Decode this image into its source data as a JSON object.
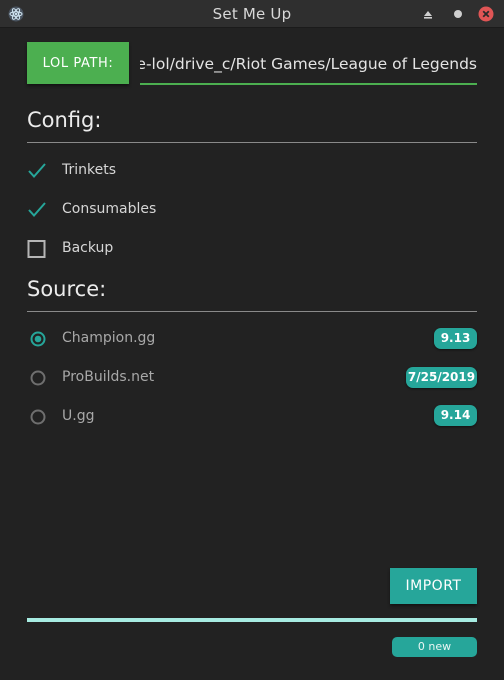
{
  "window": {
    "title": "Set Me Up",
    "icons": {
      "app": "electron-icon",
      "minimize": "minimize-icon",
      "maximize": "maximize-icon",
      "close": "close-icon"
    }
  },
  "path": {
    "button_label": "LOL PATH:",
    "value": "ge-lol/drive_c/Riot Games/League of Legends/"
  },
  "config": {
    "title": "Config:",
    "options": [
      {
        "label": "Trinkets",
        "checked": true
      },
      {
        "label": "Consumables",
        "checked": true
      },
      {
        "label": "Backup",
        "checked": false
      }
    ]
  },
  "source": {
    "title": "Source:",
    "options": [
      {
        "label": "Champion.gg",
        "selected": true,
        "badge": "9.13"
      },
      {
        "label": "ProBuilds.net",
        "selected": false,
        "badge": "7/25/2019"
      },
      {
        "label": "U.gg",
        "selected": false,
        "badge": "9.14"
      }
    ]
  },
  "import_label": "IMPORT",
  "progress": 1.0,
  "status": "0 new",
  "colors": {
    "accent_green": "#4caf50",
    "accent_teal": "#26a69a",
    "progress": "#a7ece2",
    "background": "#222222",
    "close": "#e05555"
  }
}
